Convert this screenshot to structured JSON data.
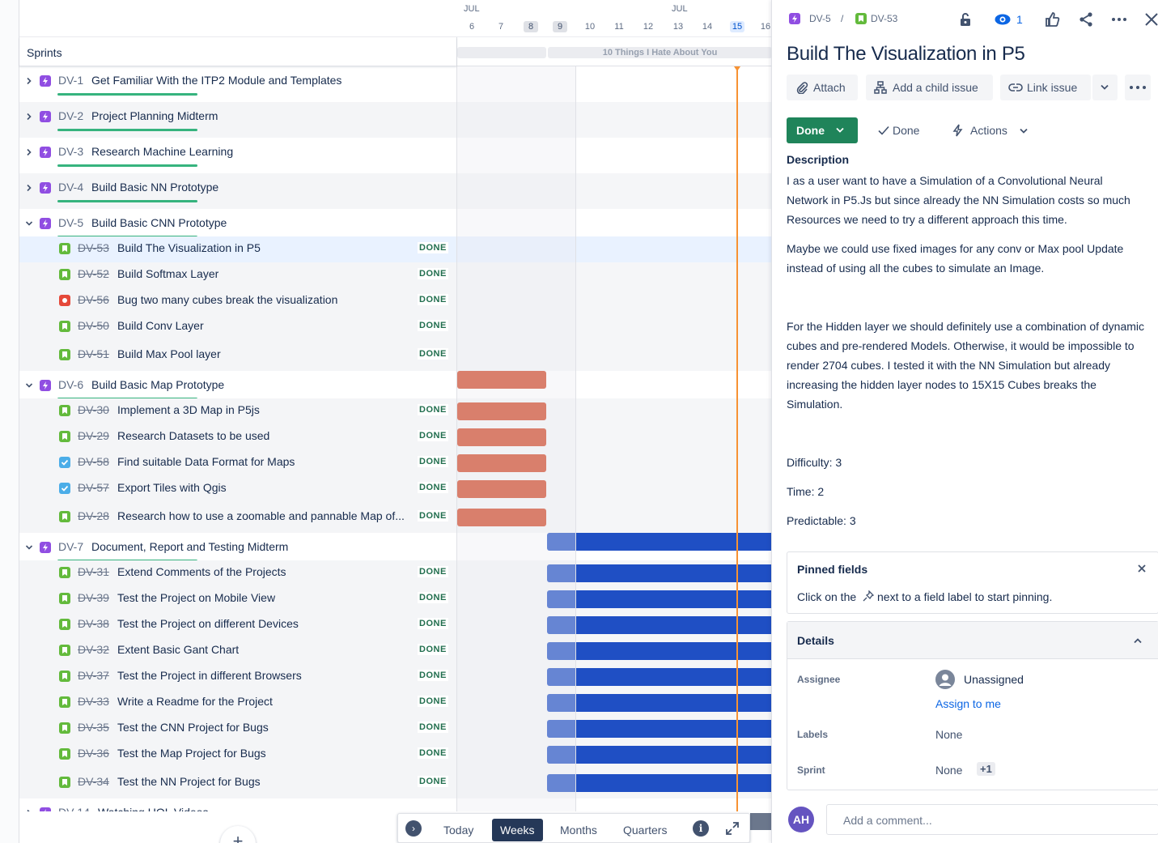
{
  "timeline": {
    "months": [
      "JUL",
      "JUL"
    ],
    "days": [
      "6",
      "7",
      "8",
      "9",
      "10",
      "11",
      "12",
      "13",
      "14",
      "15",
      "16"
    ],
    "sprints_label": "Sprints",
    "sprints": [
      {
        "label": ""
      },
      {
        "label": "10 Things I Hate About You"
      }
    ]
  },
  "rows": [
    {
      "kind": "epic",
      "key": "DV-1",
      "summary": "Get Familiar With the ITP2 Module and Templates",
      "expanded": false,
      "progress": 1.0
    },
    {
      "kind": "epic",
      "key": "DV-2",
      "summary": "Project Planning Midterm",
      "expanded": false,
      "progress": 1.0
    },
    {
      "kind": "epic",
      "key": "DV-3",
      "summary": "Research Machine Learning",
      "expanded": false,
      "progress": 1.0
    },
    {
      "kind": "epic",
      "key": "DV-4",
      "summary": "Build Basic NN Prototype",
      "expanded": false,
      "progress": 1.0
    },
    {
      "kind": "epic",
      "key": "DV-5",
      "summary": "Build Basic CNN Prototype",
      "expanded": true,
      "progress": 1.0
    },
    {
      "kind": "story",
      "key": "DV-53",
      "summary": "Build The Visualization in P5",
      "status": "DONE",
      "selected": true
    },
    {
      "kind": "story",
      "key": "DV-52",
      "summary": "Build Softmax Layer",
      "status": "DONE"
    },
    {
      "kind": "bug",
      "key": "DV-56",
      "summary": "Bug two many cubes break the visualization",
      "status": "DONE"
    },
    {
      "kind": "story",
      "key": "DV-50",
      "summary": "Build Conv Layer",
      "status": "DONE"
    },
    {
      "kind": "story",
      "key": "DV-51",
      "summary": "Build Max Pool layer",
      "status": "DONE"
    },
    {
      "kind": "epic",
      "key": "DV-6",
      "summary": "Build Basic Map Prototype",
      "expanded": true,
      "progress": 1.0,
      "bar": "red"
    },
    {
      "kind": "story",
      "key": "DV-30",
      "summary": "Implement a 3D Map in P5js",
      "status": "DONE",
      "bar": "red"
    },
    {
      "kind": "story",
      "key": "DV-29",
      "summary": "Research Datasets to be used",
      "status": "DONE",
      "bar": "red"
    },
    {
      "kind": "task",
      "key": "DV-58",
      "summary": "Find suitable Data Format for Maps",
      "status": "DONE",
      "bar": "red"
    },
    {
      "kind": "task",
      "key": "DV-57",
      "summary": "Export Tiles with Qgis",
      "status": "DONE",
      "bar": "red"
    },
    {
      "kind": "story",
      "key": "DV-28",
      "summary": "Research how to use a zoomable and pannable Map of...",
      "status": "DONE",
      "bar": "red"
    },
    {
      "kind": "epic",
      "key": "DV-7",
      "summary": "Document, Report and Testing Midterm",
      "expanded": true,
      "progress": 1.0,
      "bar": "blue"
    },
    {
      "kind": "story",
      "key": "DV-31",
      "summary": "Extend Comments of the Projects",
      "status": "DONE",
      "bar": "blue"
    },
    {
      "kind": "story",
      "key": "DV-39",
      "summary": "Test the Project on Mobile View",
      "status": "DONE",
      "bar": "blue"
    },
    {
      "kind": "story",
      "key": "DV-38",
      "summary": "Test the Project on different Devices",
      "status": "DONE",
      "bar": "blue"
    },
    {
      "kind": "story",
      "key": "DV-32",
      "summary": "Extent Basic Gant Chart",
      "status": "DONE",
      "bar": "blue"
    },
    {
      "kind": "story",
      "key": "DV-37",
      "summary": "Test the Project in different Browsers",
      "status": "DONE",
      "bar": "blue"
    },
    {
      "kind": "story",
      "key": "DV-33",
      "summary": "Write a Readme for the Project",
      "status": "DONE",
      "bar": "blue"
    },
    {
      "kind": "story",
      "key": "DV-35",
      "summary": "Test the CNN Project for Bugs",
      "status": "DONE",
      "bar": "blue"
    },
    {
      "kind": "story",
      "key": "DV-36",
      "summary": "Test the Map Project for Bugs",
      "status": "DONE",
      "bar": "blue"
    },
    {
      "kind": "story",
      "key": "DV-34",
      "summary": "Test the NN Project for Bugs",
      "status": "DONE",
      "bar": "blue"
    },
    {
      "kind": "epic",
      "key": "DV-14",
      "summary": "Watching UOL Videos",
      "expanded": false,
      "progress": 0.5
    }
  ],
  "controls": {
    "today": "Today",
    "weeks": "Weeks",
    "months": "Months",
    "quarters": "Quarters",
    "active": "weeks"
  },
  "panel": {
    "breadcrumb_parent": "DV-5",
    "breadcrumb_sep": "/",
    "breadcrumb_issue": "DV-53",
    "watchers": "1",
    "title": "Build The Visualization in P5",
    "attach": "Attach",
    "add_child": "Add a child issue",
    "link_issue": "Link issue",
    "status": "Done",
    "resolution": "Done",
    "actions": "Actions",
    "description_label": "Description",
    "description": [
      "I as a user want to have a Simulation of a Convolutional Neural Network in P5.Js but since already the NN Simulation costs so much Resources we need to try a different approach this time.",
      "Maybe we could use fixed images for any conv or Max pool Update instead of using all the cubes to simulate an Image.",
      "For the Hidden layer we should definitely use a combination of dynamic cubes and pre-rendered Models. Otherwise, it would be impossible to render 2704 cubes. I tested it with the NN Simulation but already increasing the hidden layer nodes to 15X15 Cubes breaks the Simulation.",
      "Difficulty: 3",
      "Time: 2",
      "Predictable: 3"
    ],
    "pinned_title": "Pinned fields",
    "pinned_text_before": "Click on the",
    "pinned_text_after": "next to a field label to start pinning.",
    "details_title": "Details",
    "assignee_label": "Assignee",
    "assignee_value": "Unassigned",
    "assign_to_me": "Assign to me",
    "labels_label": "Labels",
    "labels_value": "None",
    "sprint_label": "Sprint",
    "sprint_value": "None",
    "sprint_extra": "+1",
    "avatar_initials": "AH",
    "comment_placeholder": "Add a comment..."
  },
  "colors": {
    "epic": "#904ee2",
    "story": "#63ba3c",
    "bug": "#e5493a",
    "task": "#4bade8",
    "red_bar": "#d04526",
    "blue_bar": "#1f4fc4",
    "today_line": "#f79233",
    "done_green": "#1f845a"
  }
}
